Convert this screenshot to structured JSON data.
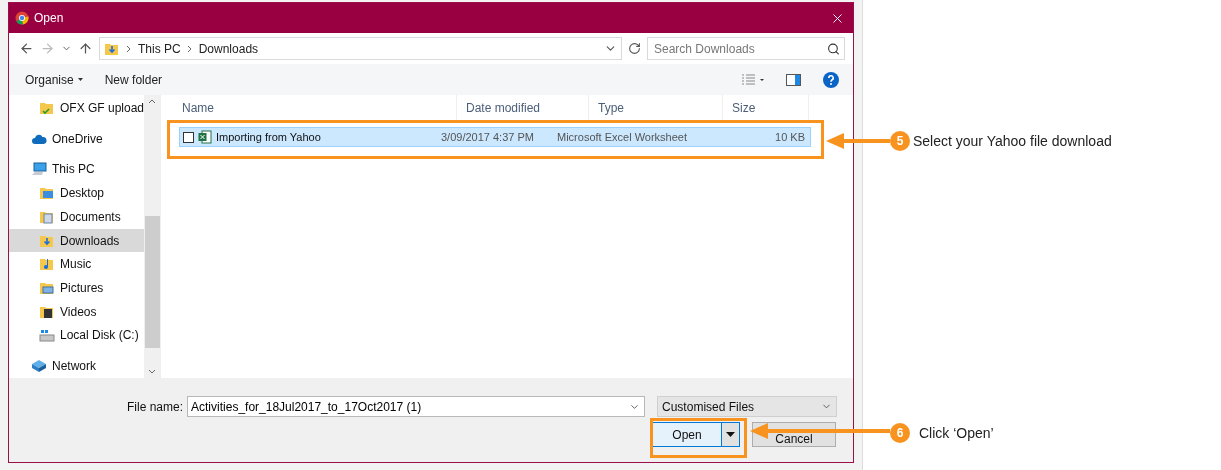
{
  "dialog": {
    "title": "Open",
    "address": {
      "path": [
        "This PC",
        "Downloads"
      ]
    },
    "search": {
      "placeholder": "Search Downloads"
    },
    "toolbar": {
      "organise": "Organise",
      "new_folder": "New folder"
    },
    "nav_pane": {
      "partial_folder": {
        "label": "OFX GF upload",
        "selected": false
      },
      "items": [
        {
          "label": "OneDrive",
          "kind": "cloud",
          "selected": false
        },
        {
          "label": "This PC",
          "kind": "computer",
          "selected": false,
          "children": [
            {
              "label": "Desktop",
              "kind": "desktop",
              "selected": false
            },
            {
              "label": "Documents",
              "kind": "documents",
              "selected": false
            },
            {
              "label": "Downloads",
              "kind": "downloads",
              "selected": true
            },
            {
              "label": "Music",
              "kind": "music",
              "selected": false
            },
            {
              "label": "Pictures",
              "kind": "pictures",
              "selected": false
            },
            {
              "label": "Videos",
              "kind": "videos",
              "selected": false
            },
            {
              "label": "Local Disk (C:)",
              "kind": "disk",
              "selected": false
            }
          ]
        },
        {
          "label": "Network",
          "kind": "network",
          "selected": false
        }
      ]
    },
    "columns": [
      "Name",
      "Date modified",
      "Type",
      "Size"
    ],
    "rows": [
      {
        "name": "Importing from Yahoo",
        "date": "3/09/2017 4:37 PM",
        "type": "Microsoft Excel Worksheet",
        "size": "10 KB",
        "selected": true,
        "checked": false
      }
    ],
    "file_name": {
      "label": "File name:",
      "value": "Activities_for_18Jul2017_to_17Oct2017 (1)"
    },
    "file_type": {
      "value": "Customised Files"
    },
    "buttons": {
      "open": "Open",
      "cancel": "Cancel"
    }
  },
  "callouts": [
    {
      "number": "5",
      "text": "Select your Yahoo file download"
    },
    {
      "number": "6",
      "text": "Click ‘Open’"
    }
  ]
}
